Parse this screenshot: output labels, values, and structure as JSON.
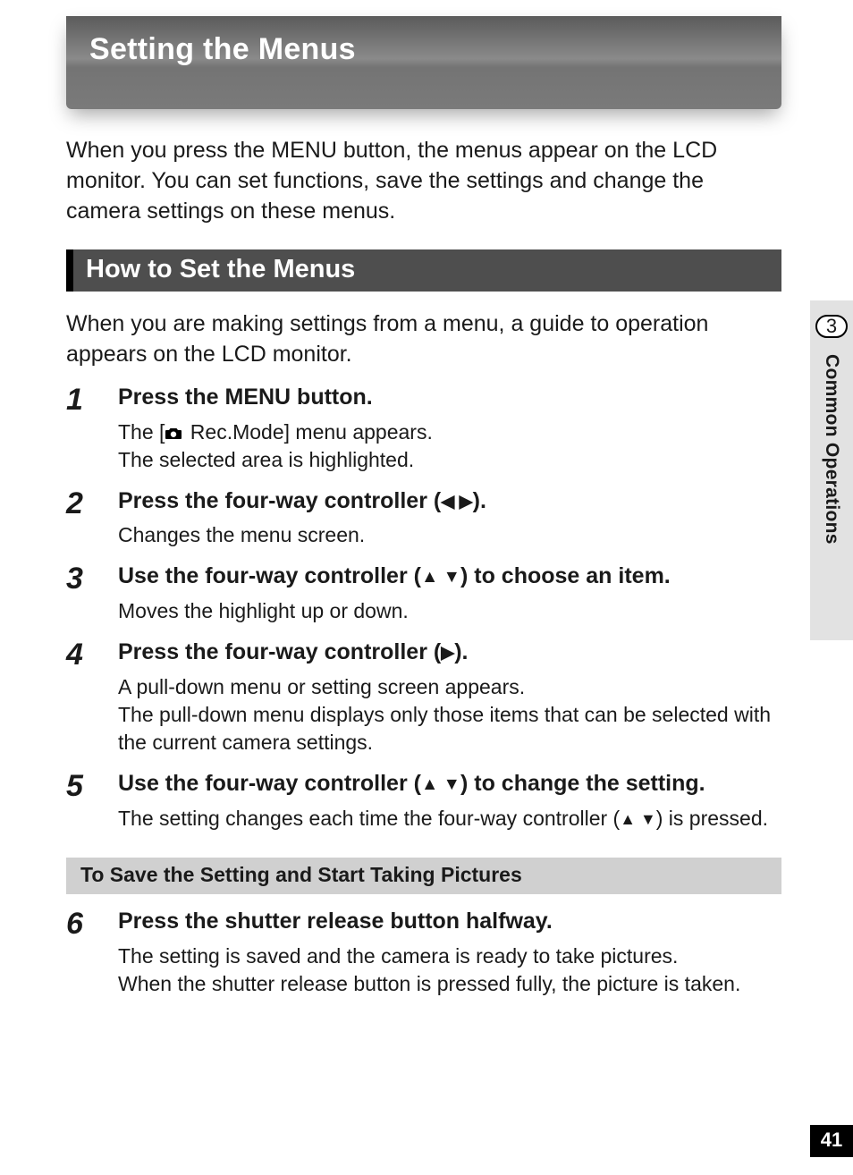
{
  "title": "Setting the Menus",
  "intro": "When you press the MENU button, the menus appear on the LCD monitor. You can set functions, save the settings and change the camera settings on these menus.",
  "section_heading": "How to Set the Menus",
  "section_intro": "When you are making settings from a menu, a guide to operation appears on the LCD monitor.",
  "steps": [
    {
      "num": "1",
      "title": "Press the MENU button.",
      "details_pre": "The [",
      "details_post": " Rec.Mode] menu appears.\nThe selected area is highlighted."
    },
    {
      "num": "2",
      "title_pre": "Press the four-way controller (",
      "title_arrows": "◀ ▶",
      "title_post": ").",
      "detail": "Changes the menu screen."
    },
    {
      "num": "3",
      "title_pre": "Use the four-way controller (",
      "title_arrows": "▲ ▼",
      "title_post": ") to choose an item.",
      "detail": "Moves the highlight up or down."
    },
    {
      "num": "4",
      "title_pre": "Press the four-way controller (",
      "title_arrows": "▶",
      "title_post": ").",
      "detail": "A pull-down menu or setting screen appears.\nThe pull-down menu displays only those items that can be selected with the current camera settings."
    },
    {
      "num": "5",
      "title_pre": "Use the four-way controller (",
      "title_arrows": "▲ ▼",
      "title_post": ") to change the setting.",
      "detail_pre": "The setting changes each time the four-way controller (",
      "detail_arrows": "▲ ▼",
      "detail_post": ") is pressed."
    }
  ],
  "sub_bar": "To Save the Setting and Start Taking Pictures",
  "steps2": [
    {
      "num": "6",
      "title": "Press the shutter release button halfway.",
      "detail": "The setting is saved and the camera is ready to take pictures.\nWhen the shutter release button is pressed fully, the picture is taken."
    }
  ],
  "side": {
    "chapter": "3",
    "label": "Common Operations"
  },
  "page_number": "41"
}
